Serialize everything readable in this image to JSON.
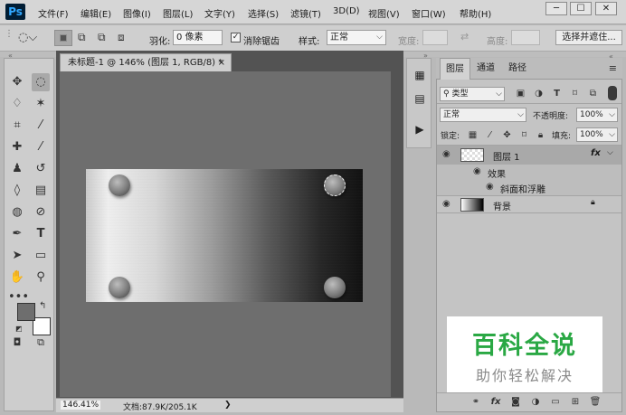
{
  "app": {
    "logo": "Ps"
  },
  "menu": [
    "文件(F)",
    "编辑(E)",
    "图像(I)",
    "图层(L)",
    "文字(Y)",
    "选择(S)",
    "滤镜(T)",
    "3D(D)",
    "视图(V)",
    "窗口(W)",
    "帮助(H)"
  ],
  "window_controls": {
    "minimize": "─",
    "restore": "☐",
    "close": "✕"
  },
  "options": {
    "feather_label": "羽化:",
    "feather_value": "0 像素",
    "antialias_label": "消除锯齿",
    "style_label": "样式:",
    "style_value": "正常",
    "width_label": "宽度:",
    "height_label": "高度:",
    "select_mask_button": "选择并遮住..."
  },
  "document": {
    "tab_title": "未标题-1 @ 146% (图层 1, RGB/8) *",
    "close": "×",
    "zoom": "146.41%",
    "doc_info": "文档:87.9K/205.1K",
    "arrow": "❯"
  },
  "layers_panel": {
    "tabs": [
      "图层",
      "通道",
      "路径"
    ],
    "filter_kind": "类型",
    "blend_mode": "正常",
    "opacity_label": "不透明度:",
    "opacity_value": "100%",
    "lock_label": "锁定:",
    "fill_label": "填充:",
    "fill_value": "100%",
    "layers": [
      {
        "name": "图层 1",
        "fx": "fx"
      },
      {
        "name": "效果"
      },
      {
        "name": "斜面和浮雕"
      },
      {
        "name": "背景"
      }
    ]
  },
  "watermark": {
    "title": "百科全说",
    "subtitle": "助你轻松解决"
  },
  "icons": {
    "tools": [
      "move-icon",
      "marquee-icon",
      "lasso-icon",
      "magic-wand-icon",
      "crop-icon",
      "eyedropper-icon",
      "healing-icon",
      "brush-icon",
      "stamp-icon",
      "history-brush-icon",
      "eraser-icon",
      "gradient-icon",
      "blur-icon",
      "dodge-icon",
      "pen-icon",
      "type-icon",
      "path-select-icon",
      "rectangle-icon",
      "hand-icon",
      "zoom-icon",
      "more-icon"
    ],
    "colors": {
      "foreground": "#6e6e6e",
      "background": "#ffffff"
    },
    "watermark_green": "#2aa844"
  }
}
